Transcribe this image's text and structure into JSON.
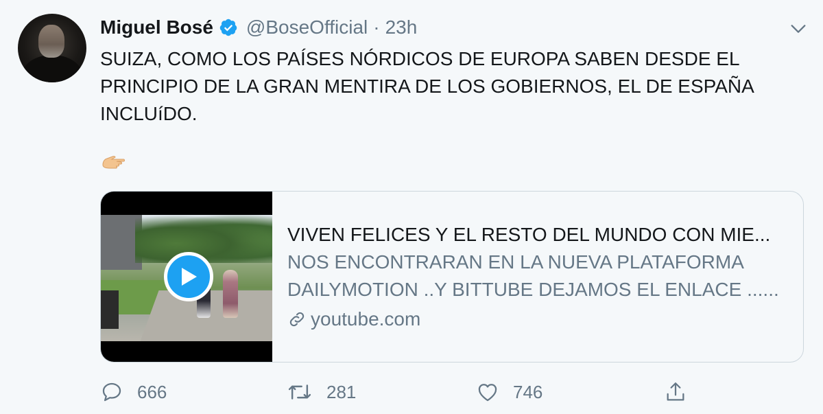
{
  "author": {
    "display_name": "Miguel Bosé",
    "handle": "@BoseOfficial",
    "separator": "·",
    "time": "23h",
    "verified": true
  },
  "tweet": {
    "text": "SUIZA, COMO LOS PAÍSES NÓRDICOS DE EUROPA SABEN DESDE EL PRINCIPIO DE LA GRAN MENTIRA DE LOS GOBIERNOS, EL DE ESPAÑA INCLUíDO.",
    "emoji": "backhand-index-pointing-right"
  },
  "card": {
    "title": "VIVEN FELICES Y EL RESTO DEL MUNDO CON MIE...",
    "description_line1": "NOS ENCONTRARAN EN LA NUEVA PLATAFORMA",
    "description_line2": "DAILYMOTION ..Y BITTUBE DEJAMOS EL ENLACE ......",
    "domain": "youtube.com"
  },
  "actions": {
    "reply_count": "666",
    "retweet_count": "281",
    "like_count": "746"
  },
  "colors": {
    "accent": "#1da1f2",
    "text": "#14171a",
    "muted": "#657786",
    "background": "#f5f8fa",
    "border": "#ccd6dd"
  },
  "icons": [
    "verified-badge-icon",
    "chevron-down-icon",
    "play-icon",
    "link-icon",
    "reply-icon",
    "retweet-icon",
    "heart-icon",
    "share-icon"
  ]
}
